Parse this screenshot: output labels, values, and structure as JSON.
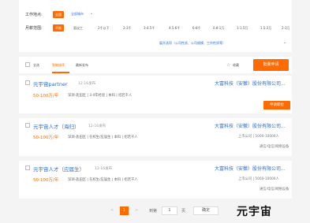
{
  "filters": {
    "city_label": "工作地点:",
    "city_selected": "全国",
    "city_change": "全部城市",
    "salary_label": "月薪范围:",
    "salary_selected": "不限",
    "salary_options": [
      "面议工",
      "2千以下",
      "2-3千",
      "3-4.5千",
      "4.5-6千",
      "6-8千",
      "0.8-1万",
      "1-1.5万",
      "1.5-2万",
      "2-3万"
    ],
    "more": "展开选项（公司性质、公司规模、工作性质等）"
  },
  "tabs": {
    "checkbox_label": "全选",
    "active": "智能排序",
    "other": "最新发布",
    "favorite": "收藏",
    "apply_button": "批量申请"
  },
  "jobs": [
    {
      "title": "元宇宙partner",
      "date": "12-16发布",
      "salary": "50-100万/年",
      "meta": "深圳-盐田区 | 3-4年经验 | 本科 | 招若干人",
      "company": "大富科技（安徽）股份有限公司...",
      "company_meta": "",
      "industry": "",
      "apply": "申请职位"
    },
    {
      "title": "元宇宙人才（海归）",
      "date": "12-16发布",
      "salary": "50-100万/年",
      "meta": "深圳-盐田区 | 在校生/应届生 | 本科 | 招若干人",
      "company": "大富科技（安徽）股份有限公司...",
      "company_meta": "上市公司 | 5000-10000人",
      "industry": "通信/电信/网络设备",
      "apply": ""
    },
    {
      "title": "元宇宙人才（应届生）",
      "date": "12-16发布",
      "salary": "50-100万/年",
      "meta": "深圳-盐田区 | 在校生/应届生 | 本科 | 招若干人",
      "company": "大富科技（安徽）股份有限公司...",
      "company_meta": "上市公司 | 5000-10000人",
      "industry": "通信/电信/网络设备",
      "apply": ""
    }
  ],
  "pagination": {
    "prev": "<",
    "current": "1",
    "next": ">",
    "total_label": "共1页",
    "goto_label": "到第",
    "goto_value": "1",
    "page_unit": "页",
    "confirm": "确定"
  },
  "watermark": "元宇宙"
}
